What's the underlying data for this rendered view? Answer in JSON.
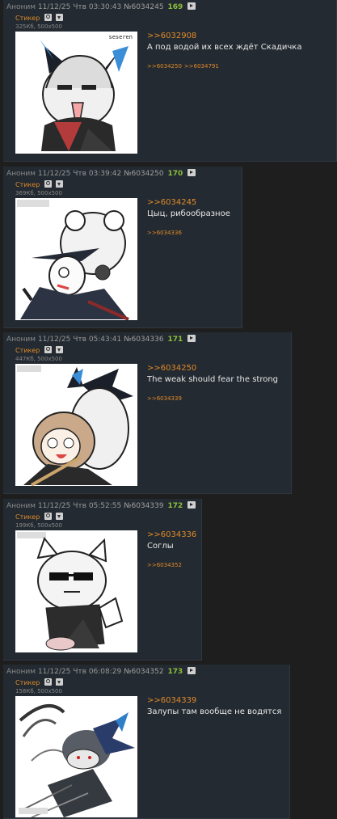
{
  "posts": [
    {
      "author": "Аноним",
      "datetime": "11/12/25 Чтв 03:30:43",
      "post_id": "№6034245",
      "number": "169",
      "file_label": "Стикер",
      "file_meta": "325Кб, 500x500",
      "quote": ">>6032908",
      "message": "А под водой их всех ждёт Скадичка",
      "backrefs": [
        ">>6034250",
        ">>6034791"
      ],
      "image_caption": "seseren"
    },
    {
      "author": "Аноним",
      "datetime": "11/12/25 Чтв 03:39:42",
      "post_id": "№6034250",
      "number": "170",
      "file_label": "Стикер",
      "file_meta": "369Кб, 500x500",
      "quote": ">>6034245",
      "message": "Цыц, рибообразное",
      "backrefs": [
        ">>6034336"
      ],
      "image_caption": ""
    },
    {
      "author": "Аноним",
      "datetime": "11/12/25 Чтв 05:43:41",
      "post_id": "№6034336",
      "number": "171",
      "file_label": "Стикер",
      "file_meta": "447Кб, 500x500",
      "quote": ">>6034250",
      "message": "The weak should fear the strong",
      "backrefs": [
        ">>6034339"
      ],
      "image_caption": ""
    },
    {
      "author": "Аноним",
      "datetime": "11/12/25 Чтв 05:52:55",
      "post_id": "№6034339",
      "number": "172",
      "file_label": "Стикер",
      "file_meta": "199Кб, 500x500",
      "quote": ">>6034336",
      "message": "Соглы",
      "backrefs": [
        ">>6034352"
      ],
      "image_caption": ""
    },
    {
      "author": "Аноним",
      "datetime": "11/12/25 Чтв 06:08:29",
      "post_id": "№6034352",
      "number": "173",
      "file_label": "Стикер",
      "file_meta": "158Кб, 500x500",
      "quote": ">>6034339",
      "message": "Залупы там вообще не водятся",
      "backrefs": [],
      "image_caption": ""
    }
  ],
  "icons": {
    "play": "play-icon",
    "search": "search-image-icon",
    "download": "download-icon"
  },
  "colors": {
    "background": "#1e1e1e",
    "post_background": "#232a31",
    "accent_orange": "#e08a2a",
    "post_number_green": "#8cbf3c"
  }
}
